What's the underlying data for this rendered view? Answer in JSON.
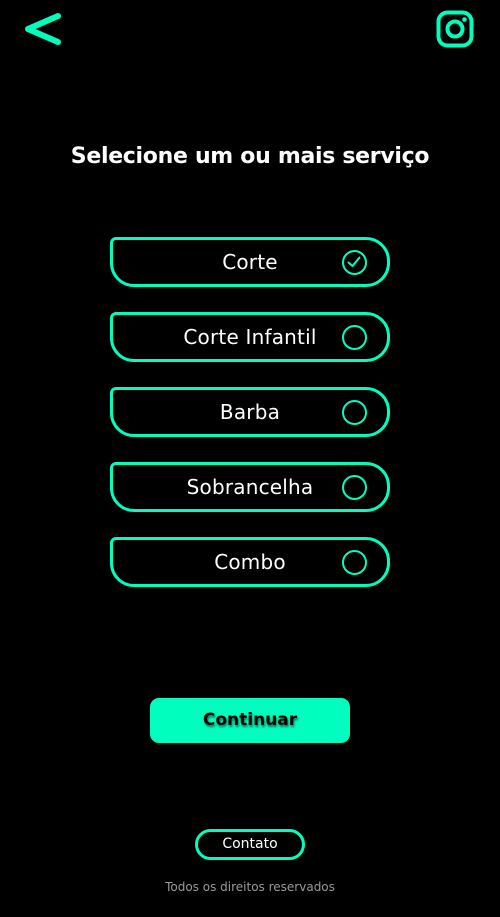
{
  "header": {
    "back_icon": "chevron-left-icon",
    "social_icon": "instagram-icon"
  },
  "title": "Selecione um ou mais serviço",
  "services": [
    {
      "label": "Corte",
      "selected": true
    },
    {
      "label": "Corte Infantil",
      "selected": false
    },
    {
      "label": "Barba",
      "selected": false
    },
    {
      "label": "Sobrancelha",
      "selected": false
    },
    {
      "label": "Combo",
      "selected": false
    }
  ],
  "continue_label": "Continuar",
  "contact_label": "Contato",
  "footer": "Todos os direitos reservados",
  "colors": {
    "accent": "#00ffbf",
    "background": "#000000",
    "text": "#ffffff",
    "footer_text": "#9a9a9a"
  }
}
